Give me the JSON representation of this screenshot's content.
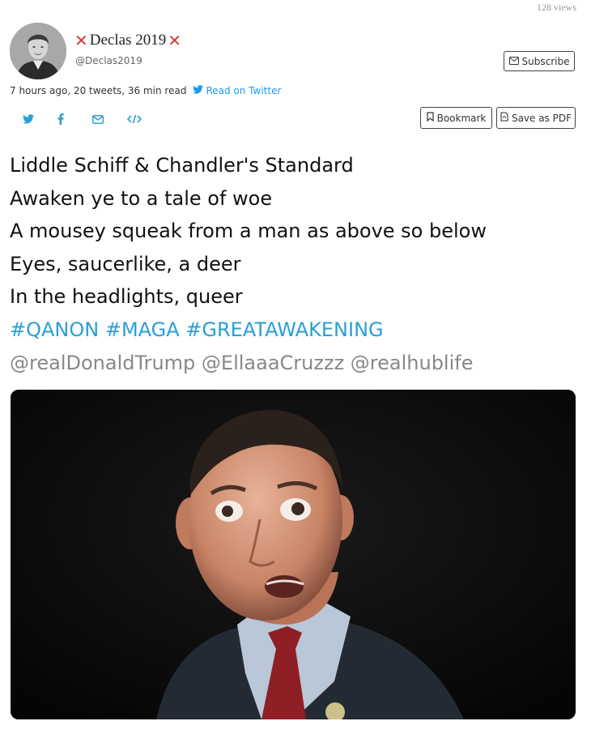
{
  "header": {
    "views": "128 views",
    "display_name": "Declas 2019",
    "handle": "@Declas2019",
    "subscribe_label": "Subscribe"
  },
  "meta": {
    "summary": "7 hours ago, 20 tweets, 36 min read",
    "read_on_twitter": "Read on Twitter"
  },
  "actions": {
    "bookmark_label": "Bookmark",
    "save_pdf_label": "Save as PDF"
  },
  "share_icons": [
    "twitter-icon",
    "facebook-icon",
    "email-icon",
    "embed-icon"
  ],
  "tweet": {
    "lines": [
      "Liddle Schiff & Chandler's Standard",
      "Awaken ye to a tale of woe",
      "A mousey squeak from a man as above so below",
      "Eyes, saucerlike, a deer",
      "In the headlights, queer"
    ],
    "hashtags": "#QANON #MAGA #GREATAWAKENING",
    "mentions": "@realDonaldTrump @EllaaaCruzzz @realhublife"
  },
  "colors": {
    "accent": "#1d9bf0",
    "hashtag": "#2a9fd6",
    "mention": "#888888",
    "x_mark": "#d23b2f"
  }
}
